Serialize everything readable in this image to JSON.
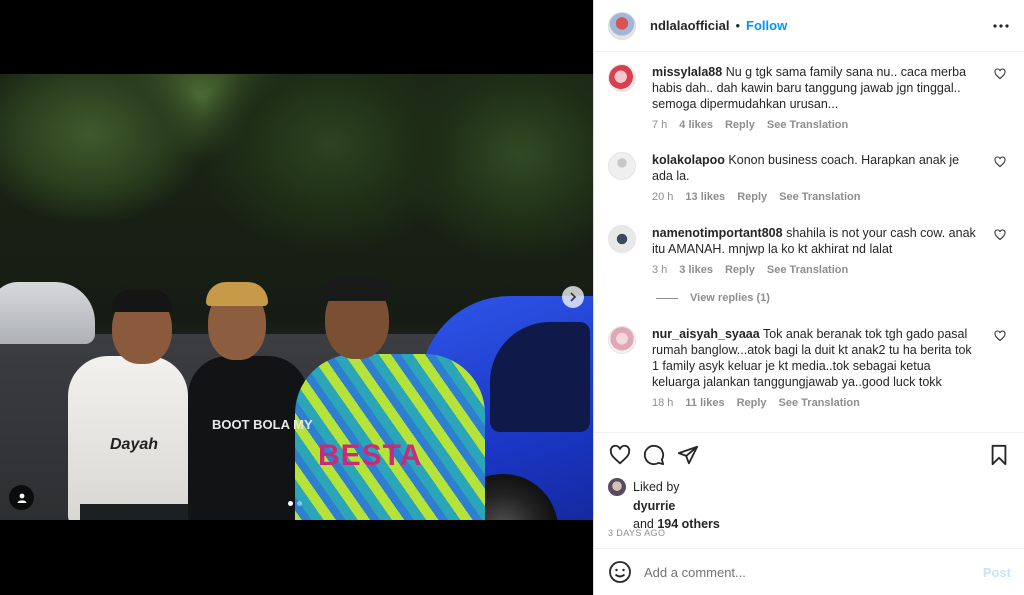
{
  "post": {
    "shirt_texts": {
      "besta": "BESTA",
      "kabot": "BOOT BOLA MY",
      "dayah": "Dayah"
    }
  },
  "header": {
    "username": "ndlalaofficial",
    "separator": "•",
    "follow_label": "Follow"
  },
  "comments": [
    {
      "user": "missylala88",
      "text": "Nu g tgk sama family sana nu.. caca merba habis dah.. dah kawin baru tanggung jawab jgn tinggal.. semoga dipermudahkan urusan...",
      "time": "7 h",
      "likes": "4 likes",
      "reply": "Reply",
      "translate": "See Translation",
      "avatar_color": "#d8404f"
    },
    {
      "user": "kolakolapoo",
      "text": "Konon business coach. Harapkan anak je ada la.",
      "time": "20 h",
      "likes": "13 likes",
      "reply": "Reply",
      "translate": "See Translation",
      "avatar_color": "#dbdbdb"
    },
    {
      "user": "namenotimportant808",
      "text": "shahila is not your cash cow. anak itu AMANAH. mnjwp la ko kt akhirat nd lalat",
      "time": "3 h",
      "likes": "3 likes",
      "reply": "Reply",
      "translate": "See Translation",
      "avatar_color": "#4a4a4a"
    },
    {
      "user": "nur_aisyah_syaaa",
      "text": "Tok anak beranak tok tgh gado pasal rumah banglow...atok bagi la duit kt anak2 tu ha berita tok 1 family asyk keluar je kt media..tok sebagai ketua keluarga jalankan tanggungjawab ya..good luck tokk",
      "time": "18 h",
      "likes": "11 likes",
      "reply": "Reply",
      "translate": "See Translation",
      "avatar_color": "#e2a7b6"
    }
  ],
  "view_replies": "View replies (1)",
  "likes": {
    "liked_by": "Liked by",
    "first_user": "dyurrie",
    "and": "and",
    "others": "194 others"
  },
  "date": "3 DAYS AGO",
  "add_comment": {
    "placeholder": "Add a comment...",
    "post_label": "Post"
  },
  "colors": {
    "accent": "#0095f6",
    "post_disabled": "#c7e3fb",
    "meta": "#8e8e8e"
  },
  "icons": [
    "heart-icon",
    "comment-icon",
    "share-icon",
    "bookmark-icon",
    "more-icon",
    "emoji-icon",
    "chevron-right-icon",
    "user-tag-icon"
  ]
}
